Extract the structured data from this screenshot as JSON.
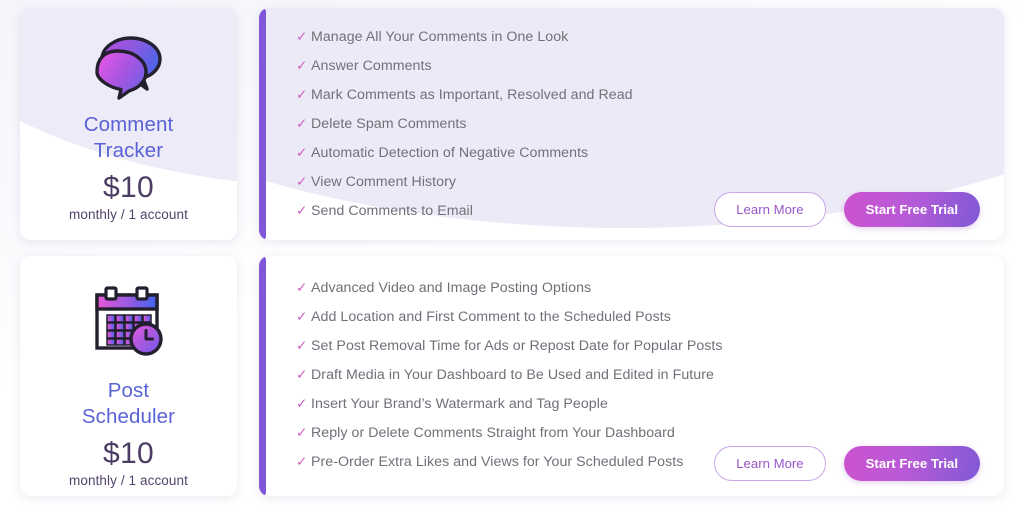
{
  "plans": [
    {
      "icon": "speech-bubbles-icon",
      "name_line1": "Comment",
      "name_line2": "Tracker",
      "price": "$10",
      "period": "monthly / 1 account",
      "features": [
        "Manage All Your Comments in One Look",
        "Answer Comments",
        "Mark Comments as Important, Resolved and Read",
        "Delete Spam Comments",
        "Automatic Detection of Negative Comments",
        "View Comment History",
        "Send Comments to Email"
      ],
      "learn_more_label": "Learn More",
      "start_trial_label": "Start Free Trial"
    },
    {
      "icon": "calendar-clock-icon",
      "name_line1": "Post",
      "name_line2": "Scheduler",
      "price": "$10",
      "period": "monthly / 1 account",
      "features": [
        "Advanced Video and Image Posting Options",
        "Add Location and First Comment to the Scheduled Posts",
        "Set Post Removal Time for Ads or Repost Date for Popular Posts",
        "Draft Media in Your Dashboard to Be Used and Edited in Future",
        "Insert Your Brand’s Watermark and Tag People",
        "Reply or Delete Comments Straight from Your Dashboard",
        "Pre-Order Extra Likes and Views for Your Scheduled Posts"
      ],
      "learn_more_label": "Learn More",
      "start_trial_label": "Start Free Trial"
    }
  ],
  "check_glyph": "✓",
  "colors": {
    "accent_bar": "#8157d9",
    "plan_name": "#5a63d6",
    "price": "#4b3c63",
    "check": "#d05fc0",
    "trial_gradient_start": "#cc52cf",
    "trial_gradient_end": "#8159d6",
    "learn_more_border": "#c9a8e8",
    "tint": "#eceaf7"
  }
}
